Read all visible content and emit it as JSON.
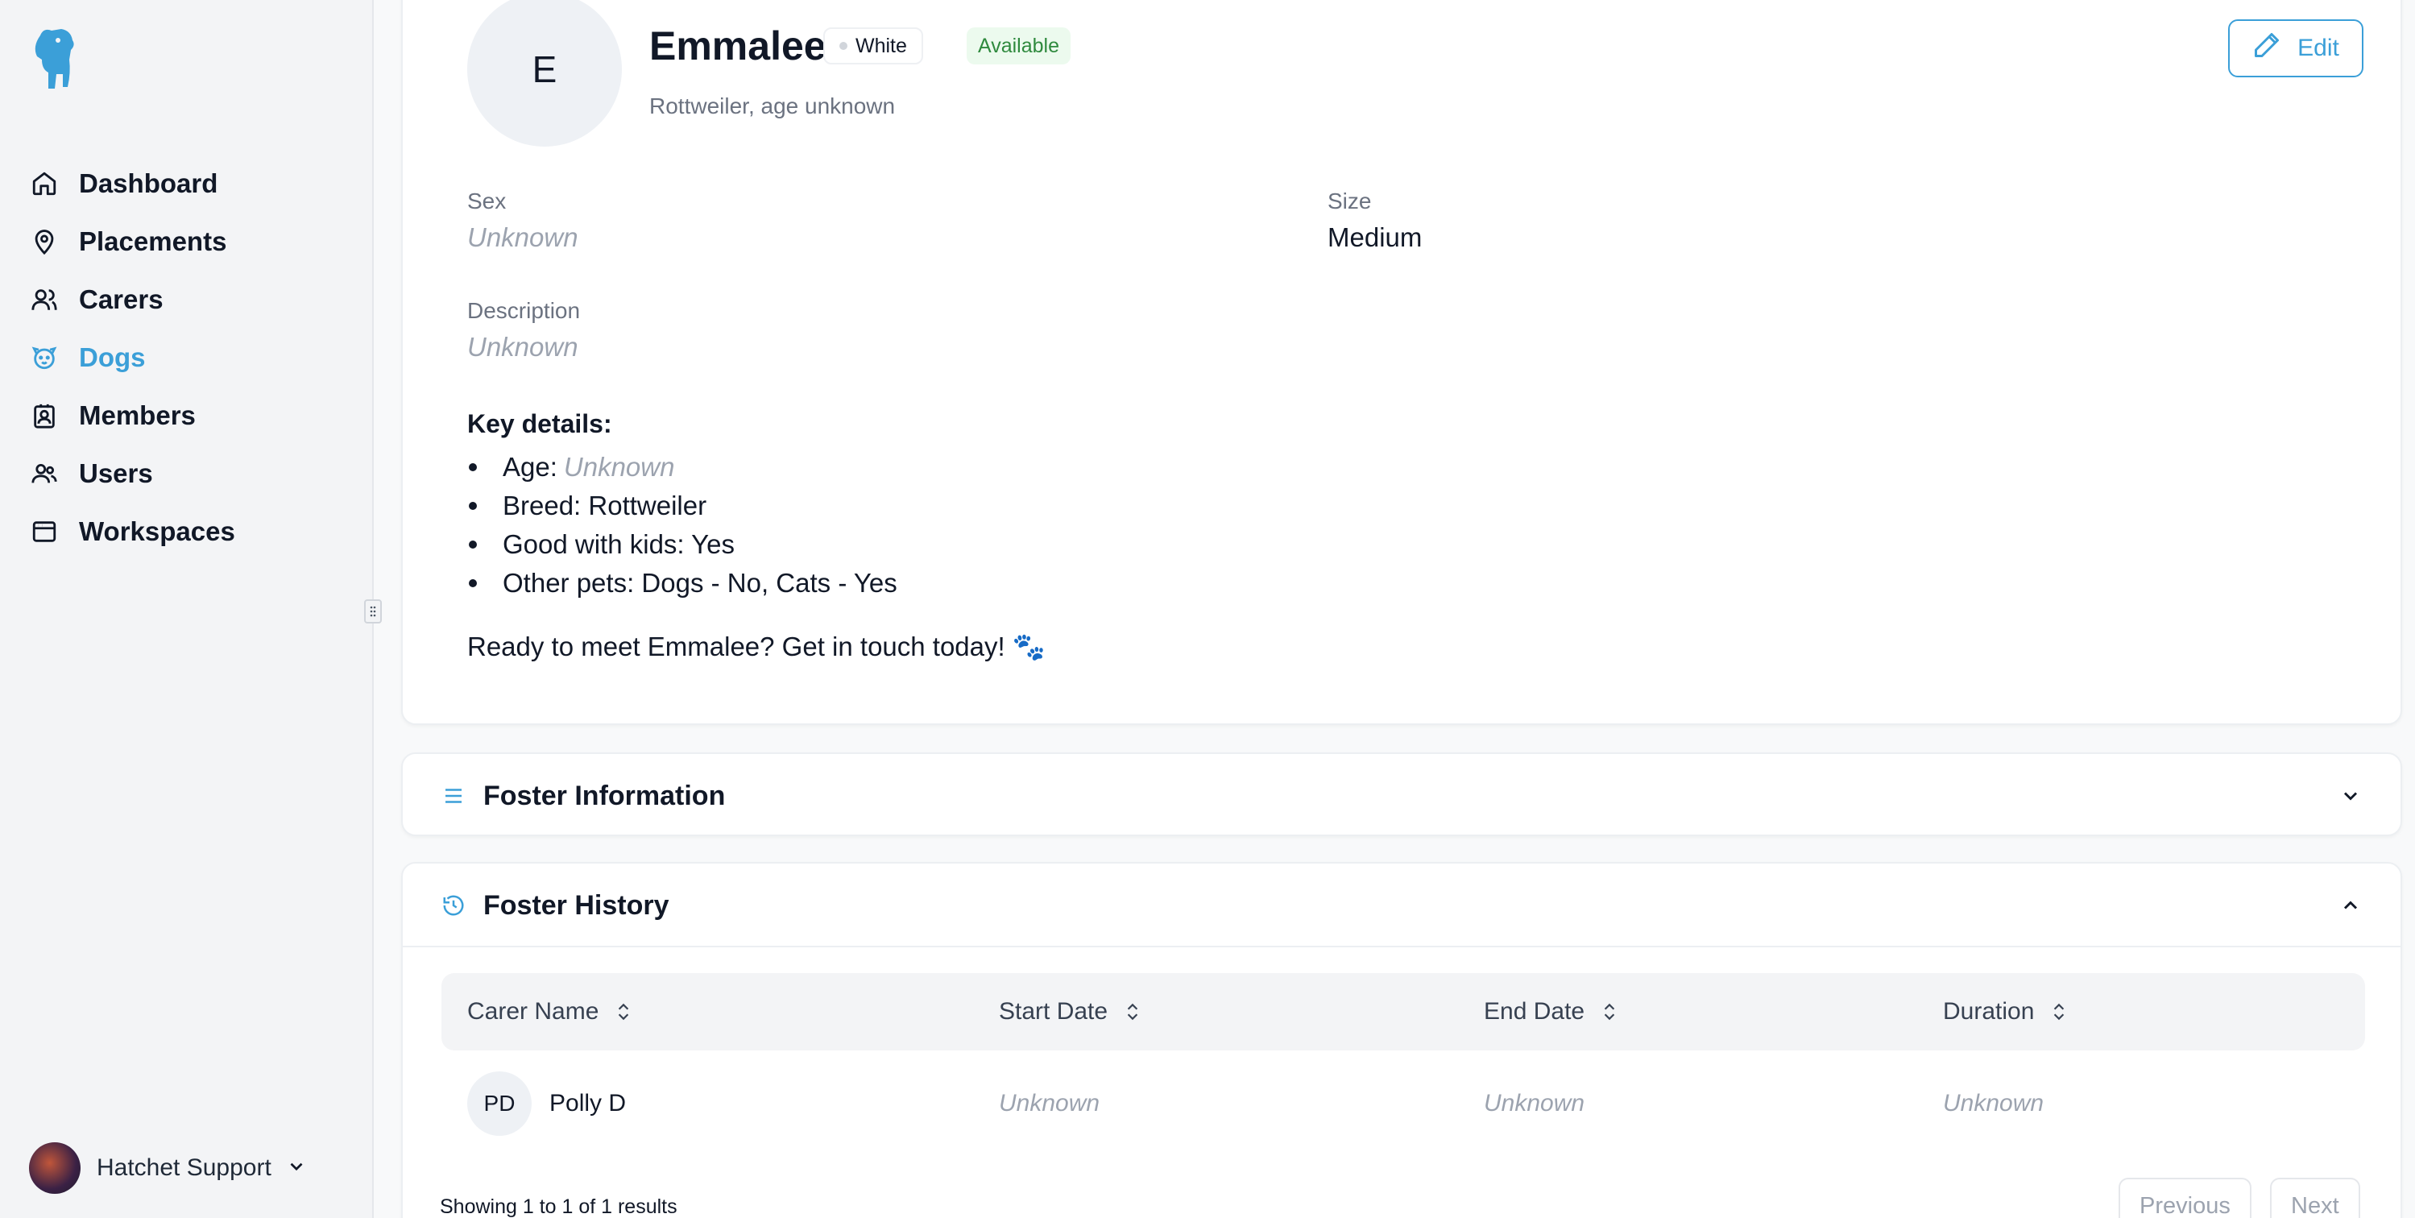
{
  "sidebar": {
    "logo": "dog-logo",
    "items": [
      {
        "label": "Dashboard",
        "icon": "home-icon"
      },
      {
        "label": "Placements",
        "icon": "map-pin-icon"
      },
      {
        "label": "Carers",
        "icon": "users-icon"
      },
      {
        "label": "Dogs",
        "icon": "dog-icon",
        "active": true
      },
      {
        "label": "Members",
        "icon": "contact-icon"
      },
      {
        "label": "Users",
        "icon": "user-group-icon"
      },
      {
        "label": "Workspaces",
        "icon": "browser-window-icon"
      }
    ],
    "user": {
      "name": "Hatchet Support"
    }
  },
  "profile": {
    "initial": "E",
    "name": "Emmalee",
    "color_badge": "White",
    "status_badge": "Available",
    "subtitle": "Rottweiler, age unknown",
    "edit_label": "Edit",
    "fields": {
      "sex_label": "Sex",
      "sex_value": "Unknown",
      "size_label": "Size",
      "size_value": "Medium",
      "description_label": "Description",
      "description_value": "Unknown"
    },
    "key_details_title": "Key details:",
    "key_details": [
      {
        "label": "Age:",
        "value": "Unknown"
      },
      {
        "label": "Breed: Rottweiler"
      },
      {
        "label": "Good with kids: Yes"
      },
      {
        "label": "Other pets: Dogs - No, Cats - Yes"
      }
    ],
    "cta": "Ready to meet Emmalee? Get in touch today! 🐾"
  },
  "foster_information": {
    "title": "Foster Information"
  },
  "foster_history": {
    "title": "Foster History",
    "columns": [
      "Carer Name",
      "Start Date",
      "End Date",
      "Duration"
    ],
    "rows": [
      {
        "initials": "PD",
        "carer": "Polly D",
        "start": "Unknown",
        "end": "Unknown",
        "duration": "Unknown"
      }
    ],
    "showing": "Showing 1 to 1 of 1 results",
    "previous": "Previous",
    "next": "Next"
  },
  "colors": {
    "accent": "#3b9fd8",
    "available_bg": "#ecfaee",
    "available_text": "#2f8a3e"
  }
}
